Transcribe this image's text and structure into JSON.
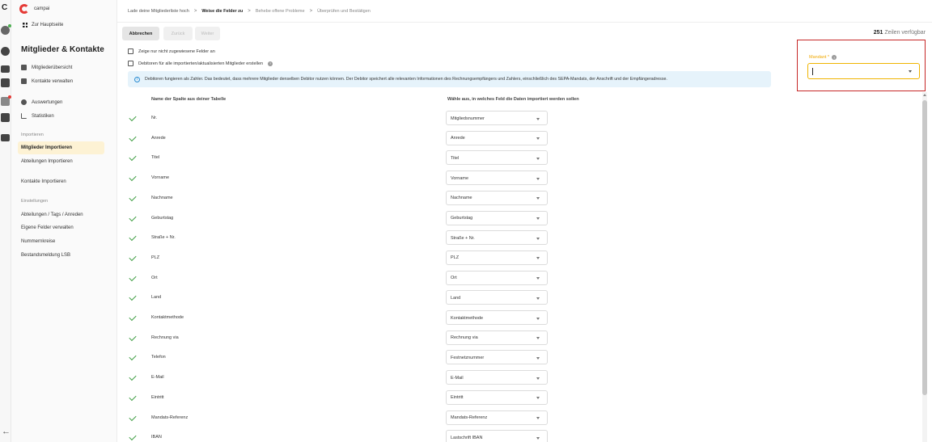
{
  "sidebar": {
    "brand": "campai",
    "home_link": "Zur Hauptseite",
    "title": "Mitglieder & Kontakte",
    "items": [
      {
        "label": "Mitgliederübersicht",
        "icon": "id-card-icon"
      },
      {
        "label": "Kontakte verwalten",
        "icon": "address-book-icon"
      },
      {
        "label": "Auswertungen",
        "icon": "pie-chart-icon"
      },
      {
        "label": "Statistiken",
        "icon": "line-chart-icon"
      }
    ],
    "import_section": "Importieren",
    "import_links": [
      "Mitglieder Importieren",
      "Abteilungen Importieren",
      "Kontakte Importieren"
    ],
    "settings_section": "Einstellungen",
    "settings_links": [
      "Abteilungen / Tags / Anreden",
      "Eigene Felder verwalten",
      "Nummernkreise",
      "Bestandsmeldung LSB"
    ]
  },
  "breadcrumb": {
    "step1": "Lade deine Mitgliederliste hoch",
    "step2": "Weise die Felder zu",
    "step3": "Behebe offene Probleme",
    "step4": "Überprüfen und Bestätigen",
    "separator": ">"
  },
  "toolbar": {
    "cancel": "Abbrechen",
    "back": "Zurück",
    "next": "Weiter",
    "rows_count": "251",
    "rows_label": "Zeilen verfügbar"
  },
  "options": {
    "show_unassigned": "Zeige nur nicht zugewiesene Felder an",
    "create_debtors": "Debitoren für alle importierten/aktualisierten Mitglieder erstellen"
  },
  "info": {
    "icon": "info-icon",
    "text": "Debitoren fungieren als Zahler. Das bedeutet, dass mehrere Mitglieder denselben Debitor nutzen können. Der Debitor speichert alle relevanten Informationen des Rechnungsempfängers und Zahlers, einschließlich des SEPA-Mandats, der Anschrift und der Empfängeradresse."
  },
  "mandant": {
    "label": "Mandant *",
    "value": ""
  },
  "table": {
    "col_source": "Name der Spalte aus deiner Tabelle",
    "col_target": "Wähle aus, in welches Feld die Daten importiert werden sollen",
    "rows": [
      {
        "source": "Nr.",
        "target": "Mitgliedsnummer"
      },
      {
        "source": "Anrede",
        "target": "Anrede"
      },
      {
        "source": "Titel",
        "target": "Titel"
      },
      {
        "source": "Vorname",
        "target": "Vorname"
      },
      {
        "source": "Nachname",
        "target": "Nachname"
      },
      {
        "source": "Geburtstag",
        "target": "Geburtstag"
      },
      {
        "source": "Straße + Nr.",
        "target": "Straße + Nr."
      },
      {
        "source": "PLZ",
        "target": "PLZ"
      },
      {
        "source": "Ort",
        "target": "Ort"
      },
      {
        "source": "Land",
        "target": "Land"
      },
      {
        "source": "Kontaktmethode",
        "target": "Kontaktmethode"
      },
      {
        "source": "Rechnung via",
        "target": "Rechnung via"
      },
      {
        "source": "Telefon",
        "target": "Festnetznummer"
      },
      {
        "source": "E-Mail",
        "target": "E-Mail"
      },
      {
        "source": "Eintritt",
        "target": "Eintritt"
      },
      {
        "source": "Mandats-Referenz",
        "target": "Mandats-Referenz"
      },
      {
        "source": "IBAN",
        "target": "Lastschrift IBAN"
      }
    ]
  },
  "colors": {
    "accent": "#f0b400",
    "highlight_frame": "#c62828",
    "check": "#43a047",
    "info_bg": "#e6f3fb",
    "active_nav": "#fdf2d4"
  }
}
